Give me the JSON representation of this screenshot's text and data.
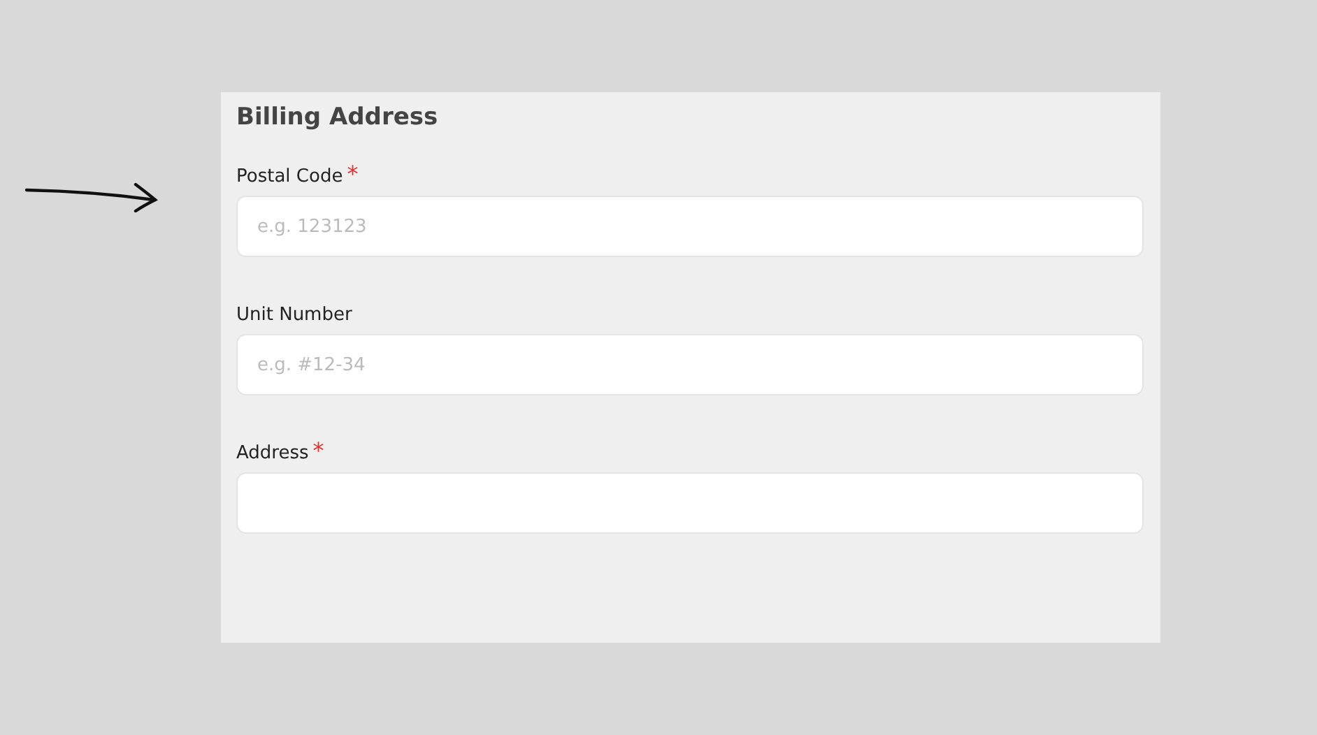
{
  "section": {
    "title": "Billing Address"
  },
  "fields": [
    {
      "label": "Postal Code",
      "required_mark": "*",
      "placeholder": "e.g. 123123"
    },
    {
      "label": "Unit Number",
      "placeholder": "e.g. #12-34"
    },
    {
      "label": "Address",
      "required_mark": "*"
    }
  ]
}
